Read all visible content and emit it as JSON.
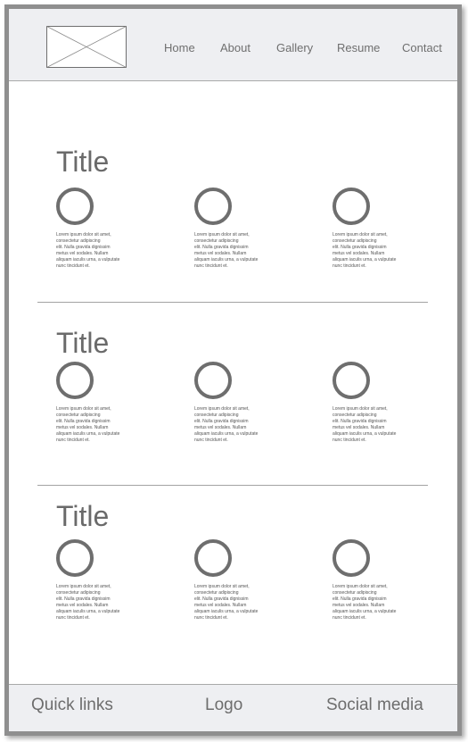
{
  "header": {
    "logo_placeholder": "image-placeholder",
    "nav": [
      "Home",
      "About",
      "Gallery",
      "Resume",
      "Contact"
    ]
  },
  "sections": [
    {
      "title": "Title",
      "items": [
        {
          "icon": "circle-icon",
          "text": "Lorem ipsum dolor sit amet,\nconsectetur adipiscing\nelit. Nulla gravida dignissim\nmetus vel sodales. Nullam\naliquam iaculis urna, a vulputate\n nunc tincidunt et."
        },
        {
          "icon": "circle-icon",
          "text": "Lorem ipsum dolor sit amet,\nconsectetur adipiscing\nelit. Nulla gravida dignissim\nmetus vel sodales. Nullam\naliquam iaculis urna, a vulputate\n nunc tincidunt et."
        },
        {
          "icon": "circle-icon",
          "text": "Lorem ipsum dolor sit amet,\nconsectetur adipiscing\nelit. Nulla gravida dignissim\nmetus vel sodales. Nullam\naliquam iaculis urna, a vulputate\n nunc tincidunt et."
        }
      ]
    },
    {
      "title": "Title",
      "items": [
        {
          "icon": "circle-icon",
          "text": "Lorem ipsum dolor sit amet,\nconsectetur adipiscing\nelit. Nulla gravida dignissim\nmetus vel sodales. Nullam\naliquam iaculis urna, a vulputate\n nunc tincidunt et."
        },
        {
          "icon": "circle-icon",
          "text": "Lorem ipsum dolor sit amet,\nconsectetur adipiscing\nelit. Nulla gravida dignissim\nmetus vel sodales. Nullam\naliquam iaculis urna, a vulputate\n nunc tincidunt et."
        },
        {
          "icon": "circle-icon",
          "text": "Lorem ipsum dolor sit amet,\nconsectetur adipiscing\nelit. Nulla gravida dignissim\nmetus vel sodales. Nullam\naliquam iaculis urna, a vulputate\n nunc tincidunt et."
        }
      ]
    },
    {
      "title": "Title",
      "items": [
        {
          "icon": "circle-icon",
          "text": "Lorem ipsum dolor sit amet,\nconsectetur adipiscing\nelit. Nulla gravida dignissim\nmetus vel sodales. Nullam\naliquam iaculis urna, a vulputate\n nunc tincidunt et."
        },
        {
          "icon": "circle-icon",
          "text": "Lorem ipsum dolor sit amet,\nconsectetur adipiscing\nelit. Nulla gravida dignissim\nmetus vel sodales. Nullam\naliquam iaculis urna, a vulputate\n nunc tincidunt et."
        },
        {
          "icon": "circle-icon",
          "text": "Lorem ipsum dolor sit amet,\nconsectetur adipiscing\nelit. Nulla gravida dignissim\nmetus vel sodales. Nullam\naliquam iaculis urna, a vulputate\n nunc tincidunt et."
        }
      ]
    }
  ],
  "footer": {
    "quick_links": "Quick links",
    "logo": "Logo",
    "social_media": "Social media"
  },
  "colors": {
    "header_bg": "#eeeff2",
    "frame_border": "#8f8f8f",
    "text_gray": "#6a6a6a"
  }
}
